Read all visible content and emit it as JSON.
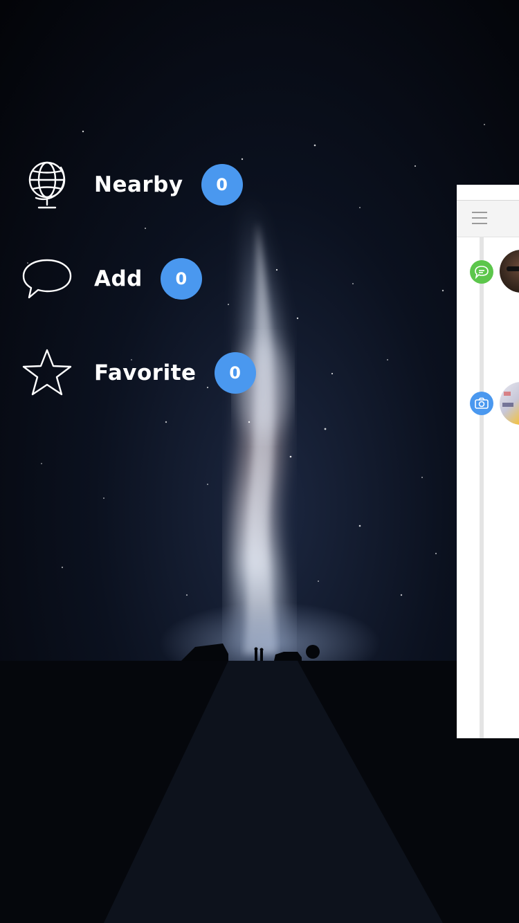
{
  "menu": {
    "items": [
      {
        "label": "Nearby",
        "count": "0",
        "icon": "globe-icon"
      },
      {
        "label": "Add",
        "count": "0",
        "icon": "speech-bubble-icon"
      },
      {
        "label": "Favorite",
        "count": "0",
        "icon": "star-icon"
      }
    ]
  },
  "panel": {
    "menu_icon": "hamburger-icon",
    "timeline": [
      {
        "type_icon": "chat-icon",
        "type_color": "#5cc64b"
      },
      {
        "type_icon": "camera-icon",
        "type_color": "#4a98ef"
      }
    ]
  },
  "colors": {
    "badge": "#4a98ef",
    "background": "#05070d",
    "chat_green": "#5cc64b",
    "camera_blue": "#4a98ef"
  }
}
